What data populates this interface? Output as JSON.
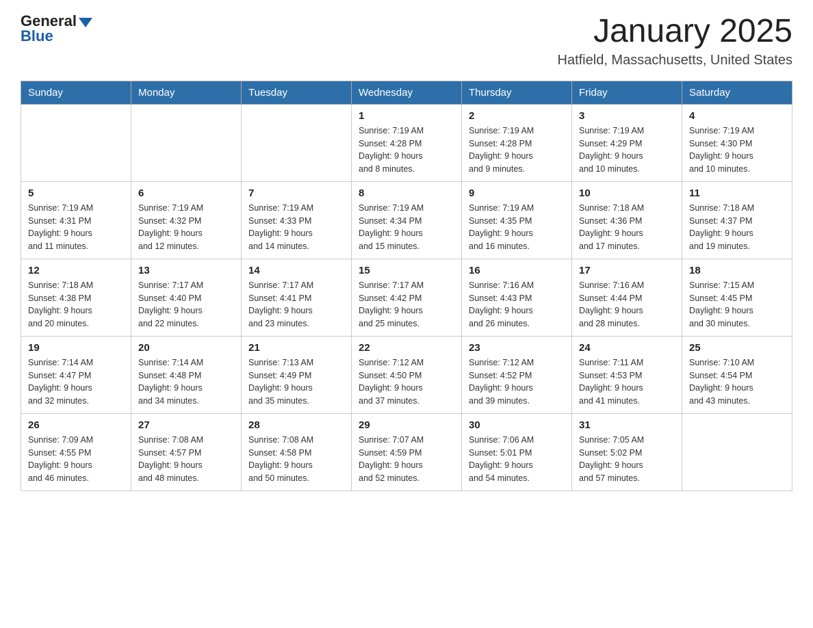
{
  "header": {
    "logo_general": "General",
    "logo_blue": "Blue",
    "month_title": "January 2025",
    "location": "Hatfield, Massachusetts, United States"
  },
  "weekdays": [
    "Sunday",
    "Monday",
    "Tuesday",
    "Wednesday",
    "Thursday",
    "Friday",
    "Saturday"
  ],
  "weeks": [
    [
      {
        "day": "",
        "info": ""
      },
      {
        "day": "",
        "info": ""
      },
      {
        "day": "",
        "info": ""
      },
      {
        "day": "1",
        "info": "Sunrise: 7:19 AM\nSunset: 4:28 PM\nDaylight: 9 hours\nand 8 minutes."
      },
      {
        "day": "2",
        "info": "Sunrise: 7:19 AM\nSunset: 4:28 PM\nDaylight: 9 hours\nand 9 minutes."
      },
      {
        "day": "3",
        "info": "Sunrise: 7:19 AM\nSunset: 4:29 PM\nDaylight: 9 hours\nand 10 minutes."
      },
      {
        "day": "4",
        "info": "Sunrise: 7:19 AM\nSunset: 4:30 PM\nDaylight: 9 hours\nand 10 minutes."
      }
    ],
    [
      {
        "day": "5",
        "info": "Sunrise: 7:19 AM\nSunset: 4:31 PM\nDaylight: 9 hours\nand 11 minutes."
      },
      {
        "day": "6",
        "info": "Sunrise: 7:19 AM\nSunset: 4:32 PM\nDaylight: 9 hours\nand 12 minutes."
      },
      {
        "day": "7",
        "info": "Sunrise: 7:19 AM\nSunset: 4:33 PM\nDaylight: 9 hours\nand 14 minutes."
      },
      {
        "day": "8",
        "info": "Sunrise: 7:19 AM\nSunset: 4:34 PM\nDaylight: 9 hours\nand 15 minutes."
      },
      {
        "day": "9",
        "info": "Sunrise: 7:19 AM\nSunset: 4:35 PM\nDaylight: 9 hours\nand 16 minutes."
      },
      {
        "day": "10",
        "info": "Sunrise: 7:18 AM\nSunset: 4:36 PM\nDaylight: 9 hours\nand 17 minutes."
      },
      {
        "day": "11",
        "info": "Sunrise: 7:18 AM\nSunset: 4:37 PM\nDaylight: 9 hours\nand 19 minutes."
      }
    ],
    [
      {
        "day": "12",
        "info": "Sunrise: 7:18 AM\nSunset: 4:38 PM\nDaylight: 9 hours\nand 20 minutes."
      },
      {
        "day": "13",
        "info": "Sunrise: 7:17 AM\nSunset: 4:40 PM\nDaylight: 9 hours\nand 22 minutes."
      },
      {
        "day": "14",
        "info": "Sunrise: 7:17 AM\nSunset: 4:41 PM\nDaylight: 9 hours\nand 23 minutes."
      },
      {
        "day": "15",
        "info": "Sunrise: 7:17 AM\nSunset: 4:42 PM\nDaylight: 9 hours\nand 25 minutes."
      },
      {
        "day": "16",
        "info": "Sunrise: 7:16 AM\nSunset: 4:43 PM\nDaylight: 9 hours\nand 26 minutes."
      },
      {
        "day": "17",
        "info": "Sunrise: 7:16 AM\nSunset: 4:44 PM\nDaylight: 9 hours\nand 28 minutes."
      },
      {
        "day": "18",
        "info": "Sunrise: 7:15 AM\nSunset: 4:45 PM\nDaylight: 9 hours\nand 30 minutes."
      }
    ],
    [
      {
        "day": "19",
        "info": "Sunrise: 7:14 AM\nSunset: 4:47 PM\nDaylight: 9 hours\nand 32 minutes."
      },
      {
        "day": "20",
        "info": "Sunrise: 7:14 AM\nSunset: 4:48 PM\nDaylight: 9 hours\nand 34 minutes."
      },
      {
        "day": "21",
        "info": "Sunrise: 7:13 AM\nSunset: 4:49 PM\nDaylight: 9 hours\nand 35 minutes."
      },
      {
        "day": "22",
        "info": "Sunrise: 7:12 AM\nSunset: 4:50 PM\nDaylight: 9 hours\nand 37 minutes."
      },
      {
        "day": "23",
        "info": "Sunrise: 7:12 AM\nSunset: 4:52 PM\nDaylight: 9 hours\nand 39 minutes."
      },
      {
        "day": "24",
        "info": "Sunrise: 7:11 AM\nSunset: 4:53 PM\nDaylight: 9 hours\nand 41 minutes."
      },
      {
        "day": "25",
        "info": "Sunrise: 7:10 AM\nSunset: 4:54 PM\nDaylight: 9 hours\nand 43 minutes."
      }
    ],
    [
      {
        "day": "26",
        "info": "Sunrise: 7:09 AM\nSunset: 4:55 PM\nDaylight: 9 hours\nand 46 minutes."
      },
      {
        "day": "27",
        "info": "Sunrise: 7:08 AM\nSunset: 4:57 PM\nDaylight: 9 hours\nand 48 minutes."
      },
      {
        "day": "28",
        "info": "Sunrise: 7:08 AM\nSunset: 4:58 PM\nDaylight: 9 hours\nand 50 minutes."
      },
      {
        "day": "29",
        "info": "Sunrise: 7:07 AM\nSunset: 4:59 PM\nDaylight: 9 hours\nand 52 minutes."
      },
      {
        "day": "30",
        "info": "Sunrise: 7:06 AM\nSunset: 5:01 PM\nDaylight: 9 hours\nand 54 minutes."
      },
      {
        "day": "31",
        "info": "Sunrise: 7:05 AM\nSunset: 5:02 PM\nDaylight: 9 hours\nand 57 minutes."
      },
      {
        "day": "",
        "info": ""
      }
    ]
  ]
}
